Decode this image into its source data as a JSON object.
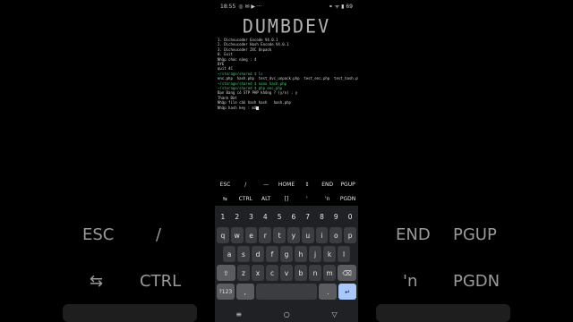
{
  "background": {
    "left_row1": [
      "ESC",
      "/"
    ],
    "left_row2": [
      "⇆",
      "CTRL"
    ],
    "right_row1": [
      "END",
      "PGUP"
    ],
    "right_row2": [
      "'n",
      "PGDN"
    ]
  },
  "status": {
    "time": "18:55",
    "left_icons": "◎ ✉ ▶ ···",
    "right_icons": "⚭ ᯤ ▮ 69"
  },
  "terminal": {
    "banner": "DUMBDEV",
    "lines": [
      "1. Dichvucoder Encode V4.0.1",
      "2. Dichvucoder Hash Encode V4.0.1",
      "3. Dichvucoder ZXC Unpack",
      "0. Exit",
      "Nhập chức năng : 4",
      "BYE",
      "quit 4C",
      "~/storage/shared $ ls",
      "enc.php  hash.php  test_dvc_unpack.php  test_enc.php  test_hash.php",
      "~/storage/shared $ nano hash.php",
      "~/storage/shared $ php enc.php",
      "Bạn Đang có STP PHP không ? (y/n) : y",
      "Thành Bừt",
      "Nhập file cần hash hash   hash.php",
      "Nhập hash key : mã"
    ],
    "prompt_indices": [
      7,
      9,
      10
    ]
  },
  "extra_keys": {
    "row1": [
      "ESC",
      "/",
      "—",
      "HOME",
      "↕",
      "END",
      "PGUP"
    ],
    "row2": [
      "⇆",
      "CTRL",
      "ALT",
      "[]",
      "'",
      "'n",
      "PGDN"
    ]
  },
  "keyboard": {
    "numbers": [
      "1",
      "2",
      "3",
      "4",
      "5",
      "6",
      "7",
      "8",
      "9",
      "0"
    ],
    "row1": [
      "q",
      "w",
      "e",
      "r",
      "t",
      "y",
      "u",
      "i",
      "o",
      "p"
    ],
    "row2": [
      "a",
      "s",
      "d",
      "f",
      "g",
      "h",
      "j",
      "k",
      "l"
    ],
    "row3": [
      "z",
      "x",
      "c",
      "v",
      "b",
      "n",
      "m"
    ],
    "shift": "⇧",
    "backspace": "⌫",
    "symbols": "?123",
    "comma": ",",
    "period": ".",
    "enter": "↵"
  },
  "navbar": {
    "menu": "≡",
    "home": "○",
    "back": "▽"
  }
}
